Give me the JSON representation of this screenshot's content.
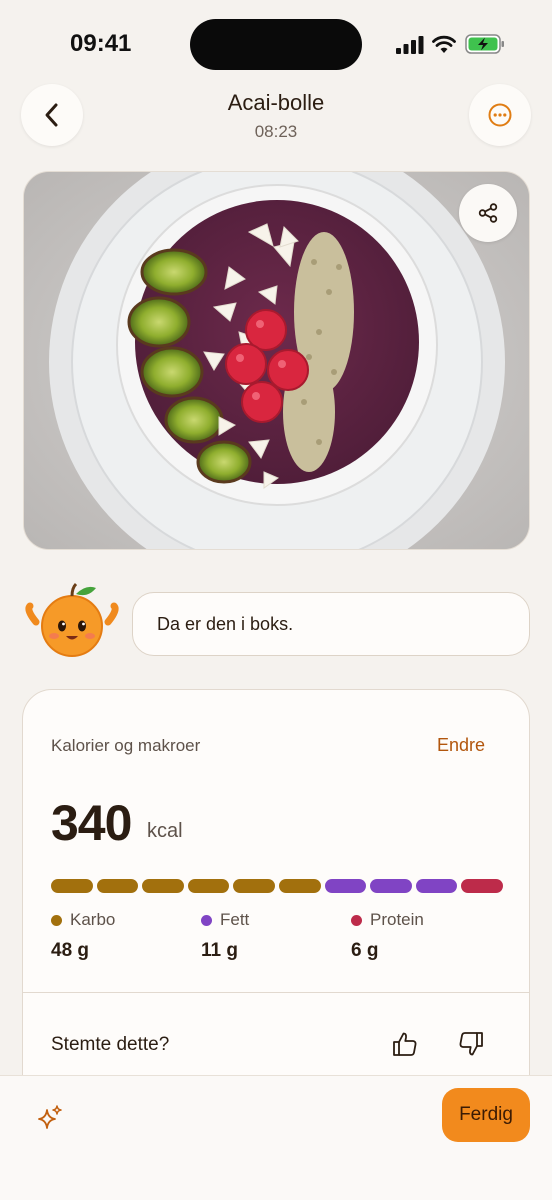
{
  "status_bar": {
    "time": "09:41"
  },
  "header": {
    "title": "Acai-bolle",
    "time": "08:23",
    "back_icon": "chevron-left-icon",
    "more_icon": "more-horizontal-circle-icon"
  },
  "photo": {
    "share_icon": "share-icon"
  },
  "assistant": {
    "message": "Da er den i boks."
  },
  "nutrition": {
    "label": "Kalorier og makroer",
    "edit_label": "Endre",
    "calories": "340",
    "unit": "kcal",
    "bar_segments": {
      "carbs": 6,
      "fat": 3,
      "protein": 1
    },
    "macros": [
      {
        "name": "Karbo",
        "value": "48 g",
        "color": "#a2700d"
      },
      {
        "name": "Fett",
        "value": "11 g",
        "color": "#8044c4"
      },
      {
        "name": "Protein",
        "value": "6 g",
        "color": "#bd2b4a"
      }
    ],
    "rating_question": "Stemte dette?"
  },
  "bottom_bar": {
    "ai_icon": "sparkles-icon",
    "done_label": "Ferdig",
    "accent": "#f28a1d"
  }
}
